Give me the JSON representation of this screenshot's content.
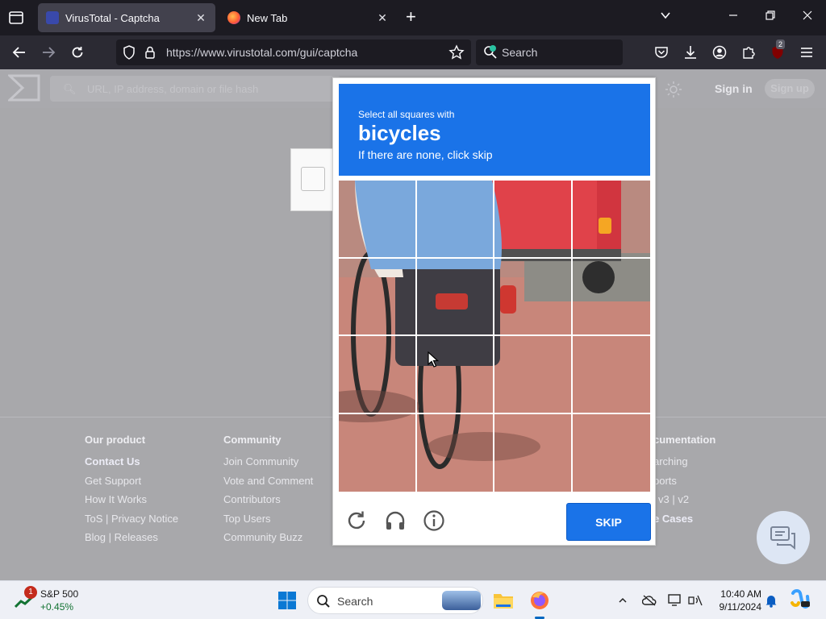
{
  "browser": {
    "tabs": [
      {
        "title": "VirusTotal - Captcha",
        "active": true
      },
      {
        "title": "New Tab",
        "active": false
      }
    ],
    "url": "https://www.virustotal.com/gui/captcha",
    "search_placeholder": "Search",
    "notification_count": "2"
  },
  "virustotal": {
    "search_placeholder": "URL, IP address, domain or file hash",
    "sign_in": "Sign in",
    "sign_up": "Sign up",
    "footer": {
      "columns": [
        {
          "heading": "Our product",
          "links": [
            "Contact Us",
            "Get Support",
            "How It Works",
            "ToS | Privacy Notice",
            "Blog | Releases"
          ]
        },
        {
          "heading": "Community",
          "links": [
            "Join Community",
            "Vote and Comment",
            "Contributors",
            "Top Users",
            "Community Buzz"
          ]
        },
        {
          "heading": "cumentation",
          "links": [
            "arching",
            "ports",
            "v3 | v2",
            "e Cases"
          ]
        }
      ]
    }
  },
  "captcha": {
    "instruction_line1": "Select all squares with",
    "target": "bicycles",
    "instruction_line3": "If there are none, click skip",
    "skip_label": "SKIP",
    "grid_rows": 4,
    "grid_cols": 4
  },
  "taskbar": {
    "stock_name": "S&P 500",
    "stock_change": "+0.45%",
    "stock_badge": "1",
    "search_placeholder": "Search",
    "time": "10:40 AM",
    "date": "9/11/2024"
  },
  "colors": {
    "captcha_blue": "#1a73e8",
    "browser_dark": "#1c1b22",
    "stock_green": "#137333"
  }
}
